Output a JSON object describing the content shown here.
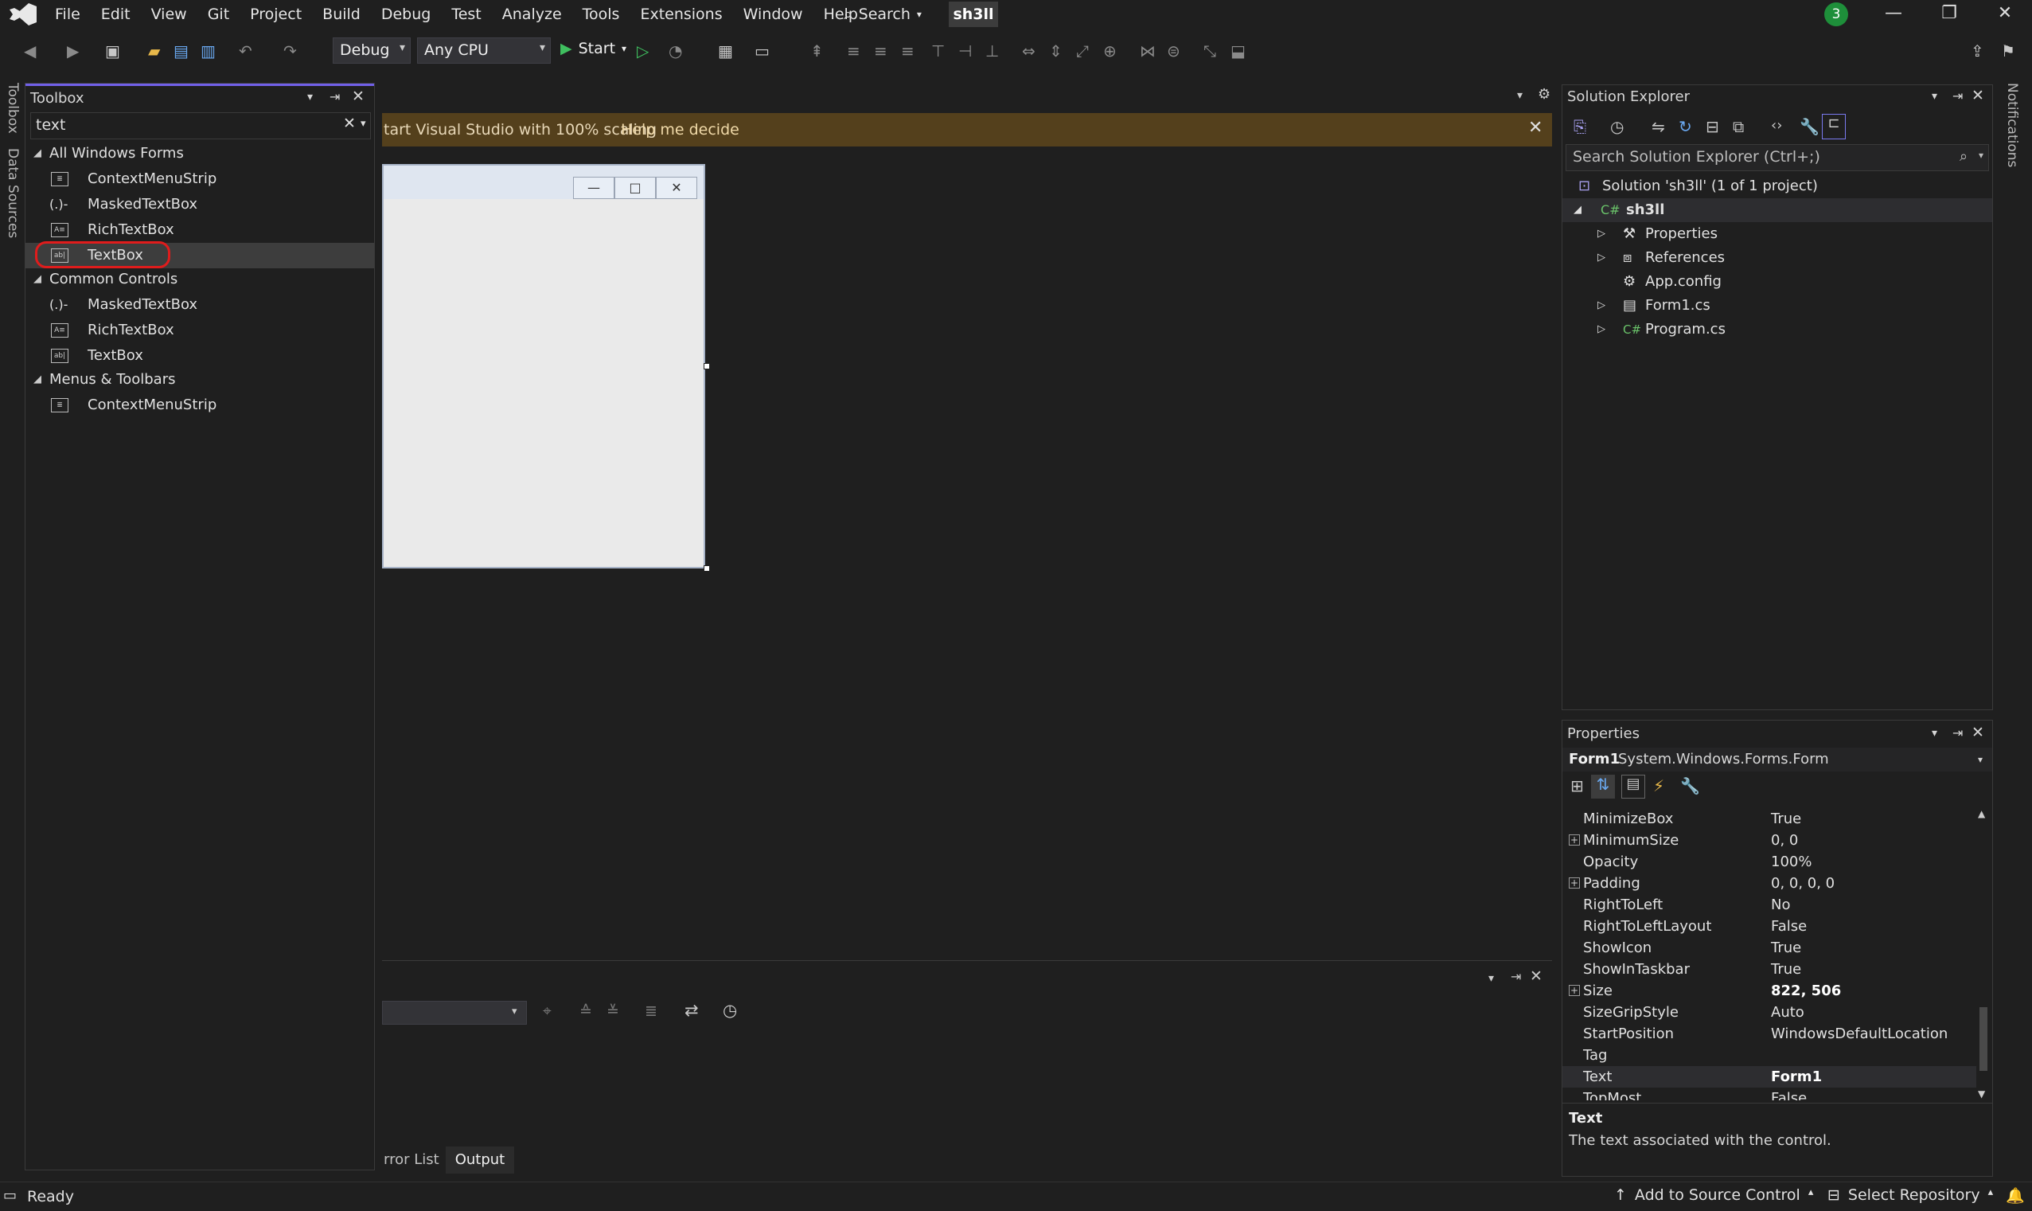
{
  "menubar": {
    "items": [
      "File",
      "Edit",
      "View",
      "Git",
      "Project",
      "Build",
      "Debug",
      "Test",
      "Analyze",
      "Tools",
      "Extensions",
      "Window",
      "Help"
    ],
    "search_label": "Search",
    "solution_name": "sh3ll",
    "notification_count": "3"
  },
  "toolbar": {
    "config": "Debug",
    "platform": "Any CPU",
    "start_label": "Start"
  },
  "side_tabs": {
    "toolbox": "Toolbox",
    "data_sources": "Data Sources",
    "notifications": "Notifications"
  },
  "toolbox": {
    "title": "Toolbox",
    "search_value": "text",
    "groups": [
      {
        "name": "All Windows Forms",
        "items": [
          "ContextMenuStrip",
          "MaskedTextBox",
          "RichTextBox",
          "TextBox"
        ]
      },
      {
        "name": "Common Controls",
        "items": [
          "MaskedTextBox",
          "RichTextBox",
          "TextBox"
        ]
      },
      {
        "name": "Menus & Toolbars",
        "items": [
          "ContextMenuStrip"
        ]
      }
    ],
    "selected_item": "TextBox"
  },
  "infobar": {
    "message": "tart Visual Studio with 100% scaling",
    "link": "Help me decide"
  },
  "output_panel": {
    "tabs": [
      "rror List",
      "Output"
    ]
  },
  "solution_explorer": {
    "title": "Solution Explorer",
    "search_placeholder": "Search Solution Explorer (Ctrl+;)",
    "solution_label": "Solution 'sh3ll' (1 of 1 project)",
    "project": "sh3ll",
    "nodes": [
      "Properties",
      "References",
      "App.config",
      "Form1.cs",
      "Program.cs"
    ]
  },
  "properties": {
    "title": "Properties",
    "object_name": "Form1",
    "object_type": "System.Windows.Forms.Form",
    "rows": [
      {
        "name": "MinimizeBox",
        "value": "True"
      },
      {
        "name": "MinimumSize",
        "value": "0, 0"
      },
      {
        "name": "Opacity",
        "value": "100%"
      },
      {
        "name": "Padding",
        "value": "0, 0, 0, 0"
      },
      {
        "name": "RightToLeft",
        "value": "No"
      },
      {
        "name": "RightToLeftLayout",
        "value": "False"
      },
      {
        "name": "ShowIcon",
        "value": "True"
      },
      {
        "name": "ShowInTaskbar",
        "value": "True"
      },
      {
        "name": "Size",
        "value": "822, 506"
      },
      {
        "name": "SizeGripStyle",
        "value": "Auto"
      },
      {
        "name": "StartPosition",
        "value": "WindowsDefaultLocation"
      },
      {
        "name": "Tag",
        "value": ""
      },
      {
        "name": "Text",
        "value": "Form1"
      },
      {
        "name": "TopMost",
        "value": "False"
      }
    ],
    "desc_title": "Text",
    "desc_body": "The text associated with the control."
  },
  "statusbar": {
    "ready": "Ready",
    "source_control": "Add to Source Control",
    "repository": "Select Repository"
  }
}
